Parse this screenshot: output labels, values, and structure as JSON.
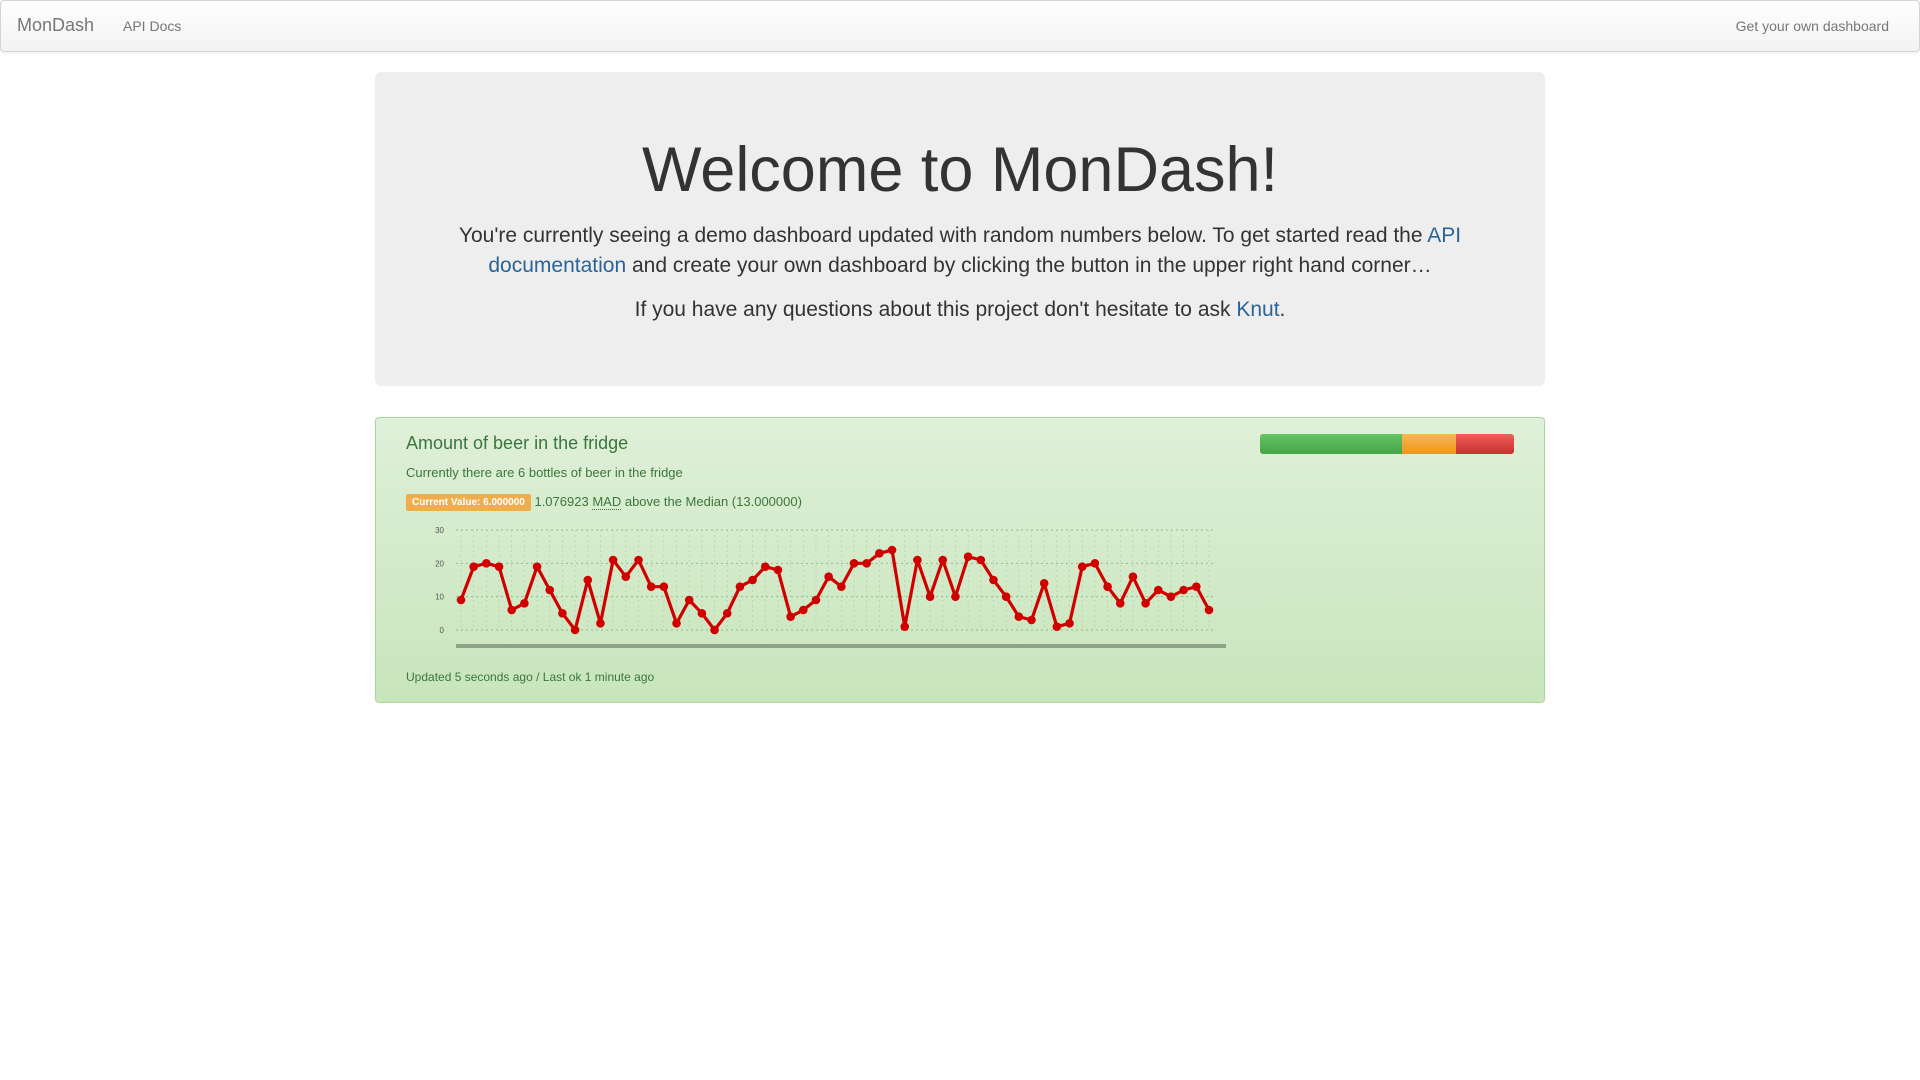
{
  "navbar": {
    "brand": "MonDash",
    "api_docs": "API Docs",
    "get_dashboard": "Get your own dashboard"
  },
  "jumbotron": {
    "title": "Welcome to MonDash!",
    "intro_before": "You're currently seeing a demo dashboard updated with random numbers below. To get started read the ",
    "intro_link": "API documentation",
    "intro_after": " and create your own dashboard by clicking the button in the upper right hand corner…",
    "questions_before": "If you have any questions about this project don't hesitate to ask ",
    "questions_link": "Knut",
    "questions_after": "."
  },
  "monitor": {
    "title": "Amount of beer in the fridge",
    "description": "Currently there are 6 bottles of beer in the fridge",
    "current_value_badge": "Current Value: 6.000000",
    "mad_value": "1.076923",
    "mad_abbr": "MAD",
    "median_text": "above the Median (13.000000)",
    "updated": "Updated 5 seconds ago / Last ok 1 minute ago",
    "status_bar": [
      {
        "status": "ok",
        "fraction": 0.56
      },
      {
        "status": "warning",
        "fraction": 0.21
      },
      {
        "status": "critical",
        "fraction": 0.23
      }
    ]
  },
  "colors": {
    "brand_link": "#2a6496",
    "success_text": "#3c763d",
    "series_line": "#d00000",
    "badge": "#f0ad4e"
  },
  "chart_data": {
    "type": "line",
    "title": "",
    "xlabel": "",
    "ylabel": "",
    "ylim": [
      0,
      30
    ],
    "yticks": [
      0,
      10,
      20,
      30
    ],
    "grid": true,
    "x_tick_labels_note": "",
    "values": [
      9,
      19,
      20,
      19,
      6,
      8,
      19,
      12,
      5,
      0,
      15,
      2,
      21,
      16,
      21,
      13,
      13,
      2,
      9,
      5,
      0,
      5,
      13,
      15,
      19,
      18,
      4,
      6,
      9,
      16,
      13,
      20,
      20,
      23,
      24,
      1,
      21,
      10,
      21,
      10,
      22,
      21,
      15,
      10,
      4,
      3,
      14,
      1,
      2,
      19,
      20,
      13,
      8,
      16,
      8,
      12,
      10,
      12,
      13,
      6
    ]
  }
}
